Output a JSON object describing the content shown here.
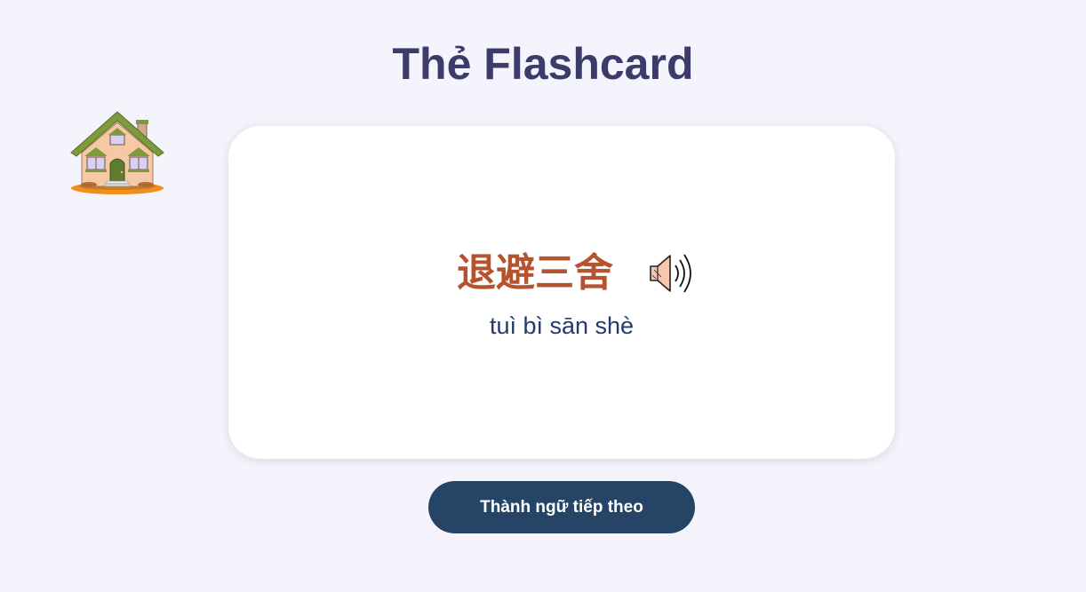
{
  "header": {
    "title": "Thẻ Flashcard"
  },
  "nav": {
    "home_icon": "house-icon"
  },
  "card": {
    "hanzi": "退避三舍",
    "pinyin": "tuì bì sān shè",
    "audio_icon": "speaker-icon"
  },
  "actions": {
    "next_label": "Thành ngữ tiếp theo"
  },
  "colors": {
    "background": "#f5f4fd",
    "title": "#3c3c6b",
    "hanzi": "#b4532e",
    "pinyin": "#233a6a",
    "button": "#264466",
    "card": "#ffffff"
  }
}
